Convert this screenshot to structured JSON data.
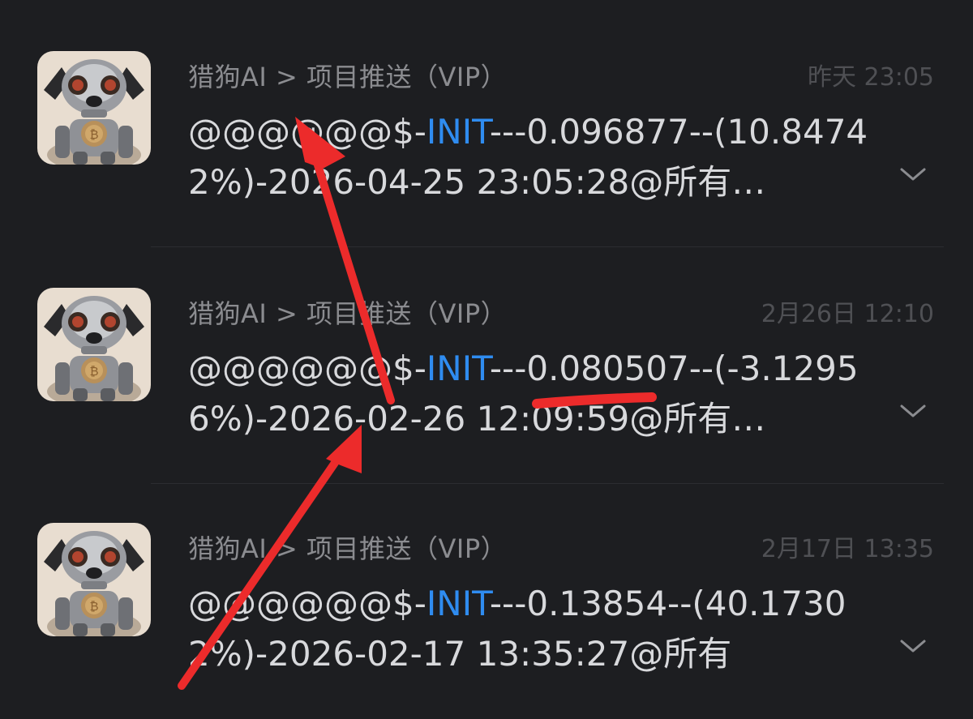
{
  "messages": [
    {
      "sender": "猎狗AI > 项目推送（VIP）",
      "time": "昨天 23:05",
      "prefix": "@@@@@@$-",
      "coin": "INIT",
      "rest": "---0.096877--(10.84742%)-2026-04-25 23:05:28@所有…"
    },
    {
      "sender": "猎狗AI > 项目推送（VIP）",
      "time": "2月26日 12:10",
      "prefix": "@@@@@@$-",
      "coin": "INIT",
      "rest": "---0.080507--(-3.12956%)-2026-02-26 12:09:59@所有…"
    },
    {
      "sender": "猎狗AI > 项目推送（VIP）",
      "time": "2月17日 13:35",
      "prefix": "@@@@@@$-",
      "coin": "INIT",
      "rest": "---0.13854--(40.17302%)-2026-02-17 13:35:27@所有"
    }
  ],
  "icons": {
    "avatar": "robot-dog-bitcoin-avatar",
    "expand": "chevron-down-icon"
  },
  "colors": {
    "background": "#1d1e21",
    "coin_highlight": "#2f8cf0",
    "annotation": "#ec2b2b"
  }
}
